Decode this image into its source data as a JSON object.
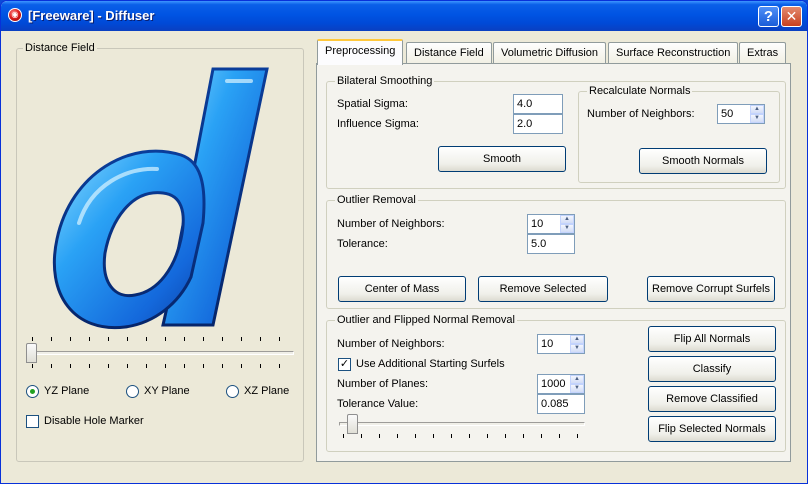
{
  "window": {
    "title": "[Freeware] - Diffuser",
    "help_label": "?",
    "close_label": "✕"
  },
  "left_panel": {
    "group_title": "Distance Field",
    "logo_letter": "d",
    "slider_value": 0,
    "planes": [
      "YZ Plane",
      "XY Plane",
      "XZ Plane"
    ],
    "selected_plane": "YZ Plane",
    "disable_hole_marker": "Disable Hole Marker"
  },
  "tabs": [
    "Preprocessing",
    "Distance Field",
    "Volumetric Diffusion",
    "Surface Reconstruction",
    "Extras"
  ],
  "active_tab": "Preprocessing",
  "bilateral": {
    "title": "Bilateral Smoothing",
    "spatial_label": "Spatial Sigma:",
    "spatial_value": "4.0",
    "influence_label": "Influence Sigma:",
    "influence_value": "2.0",
    "smooth_button": "Smooth"
  },
  "normals": {
    "title": "Recalculate Normals",
    "neighbors_label": "Number of Neighbors:",
    "neighbors_value": "50",
    "smooth_normals_button": "Smooth Normals"
  },
  "outlier": {
    "title": "Outlier Removal",
    "neighbors_label": "Number of Neighbors:",
    "neighbors_value": "10",
    "tolerance_label": "Tolerance:",
    "tolerance_value": "5.0",
    "center_button": "Center of Mass",
    "remove_selected_button": "Remove Selected",
    "remove_corrupt_button": "Remove Corrupt Surfels"
  },
  "flipped": {
    "title": "Outlier and Flipped Normal Removal",
    "neighbors_label": "Number of Neighbors:",
    "neighbors_value": "10",
    "use_additional_label": "Use Additional Starting Surfels",
    "use_additional_checked": true,
    "planes_label": "Number of Planes:",
    "planes_value": "1000",
    "tolerance_label": "Tolerance Value:",
    "tolerance_value": "0.085",
    "flip_all_button": "Flip All Normals",
    "classify_button": "Classify",
    "remove_classified_button": "Remove Classified",
    "flip_selected_button": "Flip Selected Normals"
  },
  "colors": {
    "logo_blue": "#1a6fe0",
    "logo_light": "#7fd4ff",
    "titlebar": "#0054e3"
  }
}
